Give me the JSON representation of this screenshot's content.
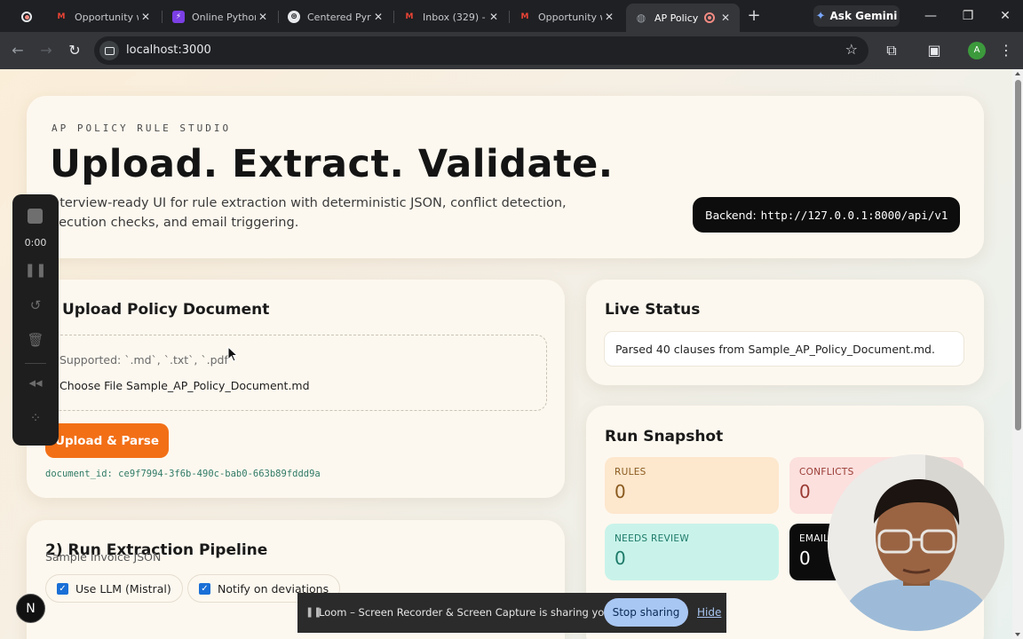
{
  "browser": {
    "tabs": [
      {
        "title": "Opportunity w",
        "favicon": "gmail-icon"
      },
      {
        "title": "Online Pythor",
        "favicon": "bolt-icon"
      },
      {
        "title": "Centered Pyra",
        "favicon": "openai-icon"
      },
      {
        "title": "Inbox (329) - ",
        "favicon": "gmail-icon"
      },
      {
        "title": "Opportunity w",
        "favicon": "gmail-icon"
      },
      {
        "title": "AP Policy",
        "favicon": "globe-icon",
        "active": true
      }
    ],
    "gemini_label": "Ask Gemini",
    "url": "localhost:3000",
    "profile_initial": "A"
  },
  "hero": {
    "eyebrow": "AP POLICY RULE STUDIO",
    "title": "Upload. Extract. Validate.",
    "subtitle_line1": "nterview-ready UI for rule extraction with deterministic JSON, conflict detection,",
    "subtitle_line2": "xecution checks, and email triggering.",
    "backend_label": "Backend:",
    "backend_url": "http://127.0.0.1:8000/api/v1"
  },
  "upload": {
    "title": "Upload Policy Document",
    "supported": "Supported: `.md`, `.txt`, `.pdf`",
    "choose_file_label": "Choose File",
    "file_name": "Sample_AP_Policy_Document.md",
    "button": "Upload & Parse",
    "document_id": "document_id: ce9f7994-3f6b-490c-bab0-663b89fddd9a"
  },
  "live_status": {
    "title": "Live Status",
    "message": "Parsed 40 clauses from Sample_AP_Policy_Document.md."
  },
  "snapshot": {
    "title": "Run Snapshot",
    "tiles": [
      {
        "label": "RULES",
        "value": "0",
        "bg": "#fde7cd",
        "fg": "#8a5a1e"
      },
      {
        "label": "CONFLICTS",
        "value": "0",
        "bg": "#fbe0de",
        "fg": "#9a3a33"
      },
      {
        "label": "NEEDS REVIEW",
        "value": "0",
        "bg": "#c9f3ea",
        "fg": "#1d7a69"
      },
      {
        "label": "EMAIL",
        "value": "0",
        "bg": "#0c0c0c",
        "fg": "#ffffff"
      }
    ]
  },
  "pipeline": {
    "title": "2) Run Extraction Pipeline",
    "use_llm": "Use LLM (Mistral)",
    "notify": "Notify on deviations",
    "sample_invoice_label": "Sample Invoice JSON"
  },
  "recorder": {
    "time": "0:00",
    "share_message": "Loom – Screen Recorder & Screen Capture is sharing your screen.",
    "stop_label": "Stop sharing",
    "hide_label": "Hide",
    "n_badge": "N"
  },
  "colors": {
    "accent_orange": "#f26f16",
    "doc_id_green": "#2f7a66",
    "checkbox_blue": "#1a6fd6"
  }
}
